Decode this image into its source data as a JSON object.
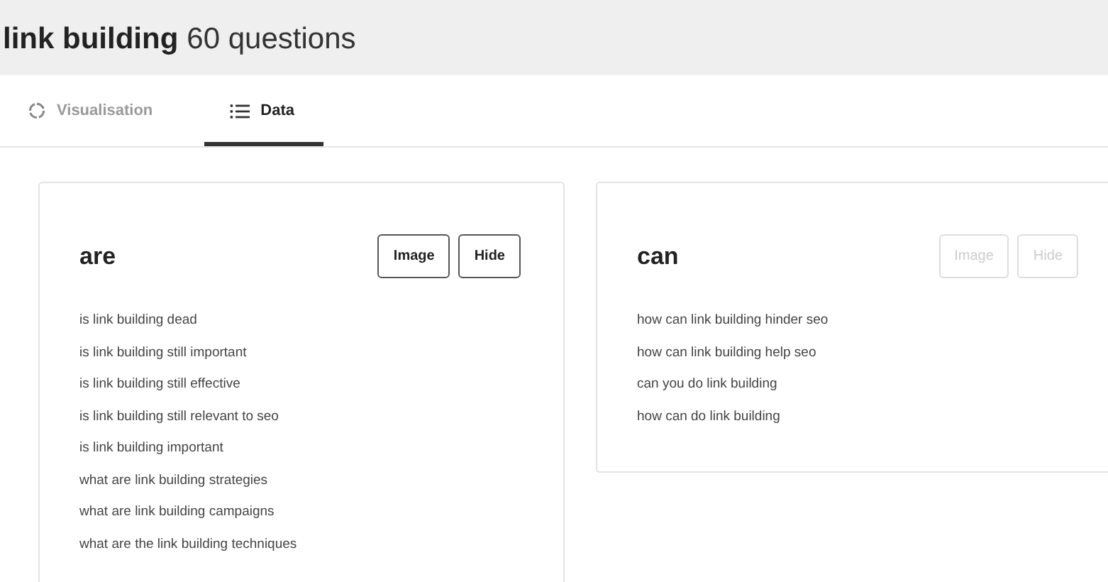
{
  "title": {
    "topic": "link building",
    "count": "60 questions"
  },
  "tabs": [
    {
      "label": "Visualisation",
      "kind": "circle",
      "selected": false
    },
    {
      "label": "Data",
      "kind": "list",
      "selected": true
    }
  ],
  "cards": [
    {
      "heading": "are",
      "buttons": [
        {
          "label": "Image",
          "disabled": false
        },
        {
          "label": "Hide",
          "disabled": false
        }
      ],
      "questions": [
        "is link building dead",
        "is link building still important",
        "is link building still effective",
        "is link building still relevant to seo",
        "is link building important",
        "what are link building strategies",
        "what are link building campaigns",
        "what are the link building techniques"
      ]
    },
    {
      "heading": "can",
      "buttons": [
        {
          "label": "Image",
          "disabled": true
        },
        {
          "label": "Hide",
          "disabled": true
        }
      ],
      "questions": [
        "how can link building hinder seo",
        "how can link building help seo",
        "can you do link building",
        "how can do link building"
      ]
    }
  ]
}
